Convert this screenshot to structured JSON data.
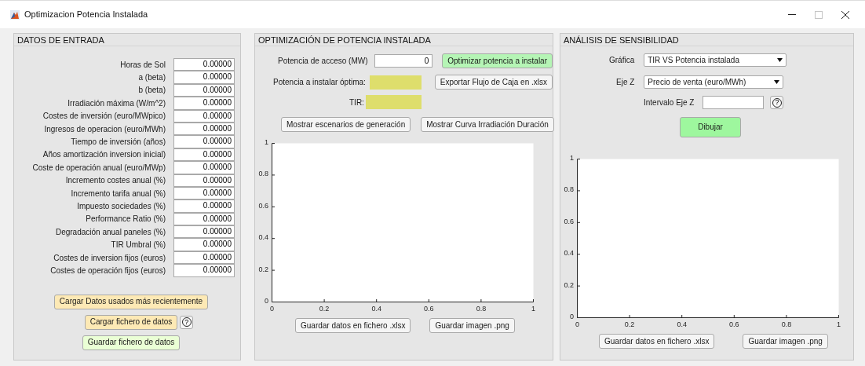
{
  "window": {
    "title": "Optimizacion Potencia Instalada",
    "controls": [
      {
        "kind": "minimize",
        "disabled": false
      },
      {
        "kind": "maximize",
        "disabled": true
      },
      {
        "kind": "close",
        "disabled": false
      }
    ]
  },
  "input_panel": {
    "title": "DATOS DE ENTRADA",
    "fields": [
      {
        "label": "Horas de Sol",
        "value": "0.00000"
      },
      {
        "label": "a (beta)",
        "value": "0.00000"
      },
      {
        "label": "b (beta)",
        "value": "0.00000"
      },
      {
        "label": "Irradiación máxima (W/m^2)",
        "value": "0.00000"
      },
      {
        "label": "Costes de inversión (euro/MWpico)",
        "value": "0.00000"
      },
      {
        "label": "Ingresos de operacion (euro/MWh)",
        "value": "0.00000"
      },
      {
        "label": "Tiempo de inversión (años)",
        "value": "0.00000"
      },
      {
        "label": "Años amortización inversion inicial)",
        "value": "0.00000"
      },
      {
        "label": "Coste de operación anual (euro/MWp)",
        "value": "0.00000"
      },
      {
        "label": "Incremento costes anual (%)",
        "value": "0.00000"
      },
      {
        "label": "Incremento tarifa anual (%)",
        "value": "0.00000"
      },
      {
        "label": "Impuesto sociedades (%)",
        "value": "0.00000"
      },
      {
        "label": "Performance Ratio (%)",
        "value": "0.00000"
      },
      {
        "label": "Degradación anual paneles (%)",
        "value": "0.00000"
      },
      {
        "label": "TIR Umbral (%)",
        "value": "0.00000"
      },
      {
        "label": "Costes de inversion fijos (euros)",
        "value": "0.00000"
      },
      {
        "label": "Costes de operación fijos (euros)",
        "value": "0.00000"
      }
    ],
    "buttons": [
      {
        "label": "Cargar Datos usados más recientemente",
        "color": "#fde9b5",
        "help": false
      },
      {
        "label": "Cargar fichero de datos",
        "color": "#fde9b5",
        "help": true,
        "help_text": "?"
      },
      {
        "label": "Guardar fichero de datos",
        "color": "#eaffd5",
        "help": false
      }
    ]
  },
  "optimization_panel": {
    "title": "OPTIMIZACIÓN DE POTENCIA INSTALADA",
    "access_power": {
      "label": "Potencia de acceso (MW)",
      "value": "0"
    },
    "optimize_button": "Optimizar potencia a instalar",
    "optimal_power": {
      "label": "Potencia a instalar óptima:"
    },
    "export_button": "Exportar Flujo de Caja en .xlsx",
    "tir": {
      "label": "TIR:"
    },
    "scenario_buttons": [
      "Mostrar escenarios de generación",
      "Mostrar Curva Irradiación Duración"
    ],
    "axes": {
      "yticks": [
        "1",
        "0.8",
        "0.6",
        "0.4",
        "0.2",
        "0"
      ],
      "xticks": [
        "0",
        "0.2",
        "0.4",
        "0.6",
        "0.8",
        "1"
      ]
    },
    "save_buttons": [
      "Guardar datos en fichero .xlsx",
      "Guardar imagen .png"
    ]
  },
  "sensitivity_panel": {
    "title": "ANÁLISIS DE SENSIBILIDAD",
    "graph": {
      "label": "Gráfica",
      "value": "TIR VS Potencia instalada"
    },
    "z_axis": {
      "label": "Eje Z",
      "value": "Precio de venta (euro/MWh)"
    },
    "z_interval": {
      "label": "Intervalo Eje Z",
      "help_text": "?"
    },
    "draw_button": "Dibujar",
    "axes": {
      "yticks": [
        "1",
        "0.8",
        "0.6",
        "0.4",
        "0.2",
        "0"
      ],
      "xticks": [
        "0",
        "0.2",
        "0.4",
        "0.6",
        "0.8",
        "1"
      ]
    },
    "save_buttons": [
      "Guardar datos en fichero .xlsx",
      "Guardar imagen .png"
    ]
  }
}
